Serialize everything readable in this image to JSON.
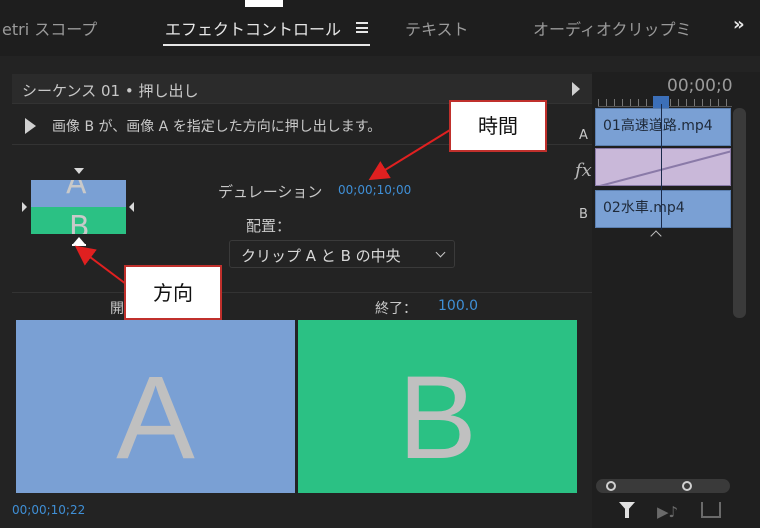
{
  "tabs": [
    {
      "label": "etri スコープ"
    },
    {
      "label": "エフェクトコントロール"
    },
    {
      "label": "テキスト"
    },
    {
      "label": "オーディオクリップミ"
    }
  ],
  "tab_more": "»",
  "sequence_header": {
    "title": "シーケンス 01 • 押し出し"
  },
  "effect_description": "画像 B が、画像 A を指定した方向に押し出します。",
  "thumbnail": {
    "a": "A",
    "b": "B"
  },
  "duration": {
    "label": "デュレーション",
    "value": "00;00;10;00"
  },
  "alignment": {
    "label": "配置：",
    "value": "クリップ A と B の中央"
  },
  "start": {
    "label": "開"
  },
  "end": {
    "label": "終了：",
    "value": "100.0"
  },
  "preview": {
    "a": "A",
    "b": "B"
  },
  "current_timecode": "00;00;10;22",
  "timeline": {
    "time": "00;00;0",
    "track_a_label": "A",
    "track_b_label": "B",
    "clip_a": "01高速道路.mp4",
    "clip_b": "02水車.mp4",
    "fx_label": "fx"
  },
  "annotations": {
    "time": "時間",
    "direction": "方向"
  },
  "colors": {
    "clip_a": "#7aa0d4",
    "clip_b": "#2bc184",
    "accent_blue": "#3f8fd6",
    "callout_border": "#c0302c"
  }
}
